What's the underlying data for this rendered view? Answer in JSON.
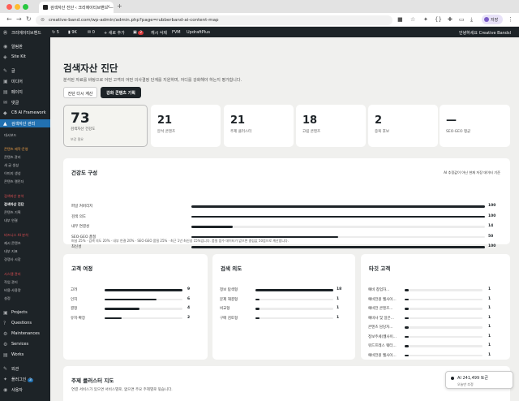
{
  "browser": {
    "tab_title": "검색자산 진단 ‹ 크리에이티브밴드 —",
    "url": "creative-band.com/wp-admin/admin.php?page=rubberband-ai-content-map",
    "profile_label": "저장"
  },
  "adminbar": {
    "site": "크리에이티브밴드",
    "updates": "5",
    "views": "9K",
    "comments": "0",
    "new": "+ 새로 추가",
    "notif_count": "2",
    "cache": "캐시 삭제",
    "fvm": "FVM",
    "updraft": "UpdraftPlus",
    "greeting": "안녕하세요 Creative Bandsl"
  },
  "sidebar": {
    "items": [
      {
        "label": "알림판",
        "icon": "◉"
      },
      {
        "label": "Site Kit",
        "icon": "◈"
      },
      {
        "label": "글",
        "icon": "✎"
      },
      {
        "label": "미디어",
        "icon": "▣"
      },
      {
        "label": "페이지",
        "icon": "▤"
      },
      {
        "label": "댓글",
        "icon": "✉"
      },
      {
        "label": "CB AI Framework",
        "icon": "◆"
      },
      {
        "label": "검색자산 관리",
        "icon": "▲"
      }
    ],
    "dashboard_sub": "대시보드",
    "group1_title": "콘텐츠 제작·운영",
    "group1": [
      "콘텐츠 관리",
      "새 글 생성",
      "이미지 생성",
      "콘텐츠 캘린더"
    ],
    "group2_title": "검색자산 분석",
    "group2": [
      "검색자산 진단",
      "콘텐츠 기획",
      "내부 연결"
    ],
    "group3_title": "비즈니스 AI 분석",
    "group3": [
      "제시 콘텐츠",
      "내부 지표",
      "경쟁사 시장"
    ],
    "group4_title": "시스템 관리",
    "group4": [
      "작업 관리",
      "비용·사용량",
      "설정"
    ],
    "bottom": [
      {
        "label": "Projects",
        "icon": "▣"
      },
      {
        "label": "Questions",
        "icon": "?"
      },
      {
        "label": "Maintenances",
        "icon": "⚙"
      },
      {
        "label": "Services",
        "icon": "⚙"
      },
      {
        "label": "Works",
        "icon": "▤"
      },
      {
        "label": "외관",
        "icon": "✎"
      },
      {
        "label": "플러그인",
        "icon": "✦",
        "badge": "3"
      },
      {
        "label": "사용자",
        "icon": "◉"
      }
    ]
  },
  "page": {
    "title": "검색자산 진단",
    "description": "분석된 자료를 바탕으로 어떤 고객의 어떤 의사결정 단계를 지원하며, 어디를 강화해야 하는지 평가합니다.",
    "btn_recalc": "진단 다시 계산",
    "btn_plan": "강화 콘텐츠 기획"
  },
  "kpis": [
    {
      "value": "73",
      "label": "검색자산 건강도",
      "sub": "보강 필요"
    },
    {
      "value": "21",
      "label": "분석 콘텐츠"
    },
    {
      "value": "21",
      "label": "주제 클러스터"
    },
    {
      "value": "18",
      "label": "고립 콘텐츠"
    },
    {
      "value": "2",
      "label": "중복 후보"
    },
    {
      "value": "—",
      "label": "SEO·GEO 평균"
    }
  ],
  "health": {
    "title": "건강도 구성",
    "note": "AI 추정값이 아닌 현재 저장 데이터 기준",
    "rows": [
      {
        "label": "퍼널 커버리지",
        "value": 100
      },
      {
        "label": "검색 의도",
        "value": 100
      },
      {
        "label": "내부 연결성",
        "value": 14
      },
      {
        "label": "SEO·GEO 품질",
        "value": 50
      },
      {
        "label": "최신성",
        "value": 100
      }
    ],
    "formula": "퍼널 25% · 검색 의도 20% · 내부 연결 20% · SEO·GEO 품질 25% · 최근 1년 최신성 15%입니다. 품질 점수 데이터가 없으면 중립값 50점으로 계산합니다."
  },
  "journey": {
    "title": "고객 여정",
    "rows": [
      {
        "label": "고려",
        "value": 9
      },
      {
        "label": "인지",
        "value": 6
      },
      {
        "label": "결정",
        "value": 4
      },
      {
        "label": "유지·확장",
        "value": 2
      }
    ],
    "max": 9
  },
  "intent": {
    "title": "검색 의도",
    "rows": [
      {
        "label": "정보 탐색형",
        "value": 18
      },
      {
        "label": "문제 해결형",
        "value": 1
      },
      {
        "label": "비교형",
        "value": 1
      },
      {
        "label": "구매 검토형",
        "value": 1
      }
    ],
    "max": 18
  },
  "target": {
    "title": "타깃 고객",
    "rows": [
      {
        "label": "예비 창업자...",
        "value": 1
      },
      {
        "label": "예비전원 웹사이...",
        "value": 1
      },
      {
        "label": "예비전 콘텐츠...",
        "value": 1
      },
      {
        "label": "예비사 및 일은...",
        "value": 1
      },
      {
        "label": "콘텐츠 담당자...",
        "value": 1
      },
      {
        "label": "정보주세(웹사이...",
        "value": 1
      },
      {
        "label": "워드프레스 웨터...",
        "value": 1
      },
      {
        "label": "예비전원 웹사이...",
        "value": 1
      }
    ],
    "max": 18
  },
  "cluster": {
    "title": "주제 클러스터 지도",
    "description": "연결 서비스가 있으면 서비스별로, 없으면 주요 주제별로 묶습니다."
  },
  "toast": {
    "title": "AI 241,499 토큰",
    "sub": "오늘만 추정"
  },
  "colors": {
    "accent": "#1d2327",
    "wp_blue": "#2271b1",
    "orange": "#f0a046",
    "red": "#e65054"
  }
}
